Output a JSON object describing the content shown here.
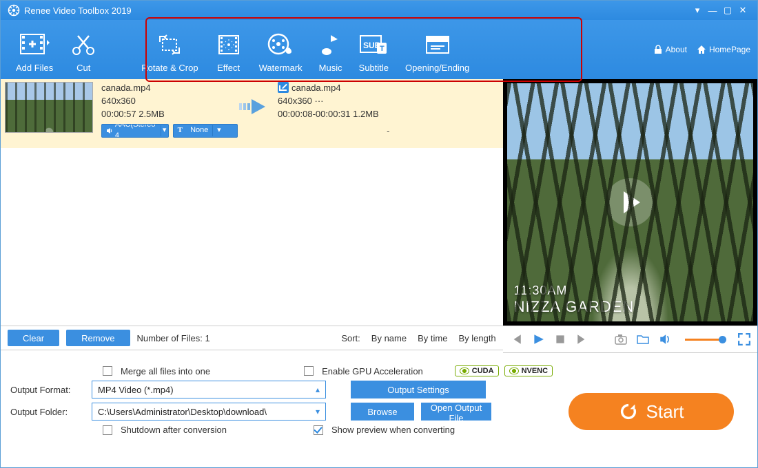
{
  "title": "Renee Video Toolbox 2019",
  "toolbar": {
    "add_files": "Add Files",
    "cut": "Cut",
    "rotate_crop": "Rotate & Crop",
    "effect": "Effect",
    "watermark": "Watermark",
    "music": "Music",
    "subtitle": "Subtitle",
    "opening_ending": "Opening/Ending",
    "about": "About",
    "homepage": "HomePage"
  },
  "file": {
    "src_name": "canada.mp4",
    "src_res": "640x360",
    "src_dur_size": "00:00:57  2.5MB",
    "dst_name": "canada.mp4",
    "dst_res": "640x360     ···",
    "dst_range_size": "00:00:08-00:00:31  1.2MB",
    "audio_pill": "AAC(Stereo 4",
    "text_pill": "None",
    "dash": "-"
  },
  "preview": {
    "time": "11:30AM",
    "place": "NIZZA GARDEN"
  },
  "footer": {
    "clear": "Clear",
    "remove": "Remove",
    "count_label": "Number of Files:  1",
    "sort_label": "Sort:",
    "by_name": "By name",
    "by_time": "By time",
    "by_length": "By length"
  },
  "settings": {
    "merge": "Merge all files into one",
    "gpu": "Enable GPU Acceleration",
    "cuda": "CUDA",
    "nvenc": "NVENC",
    "out_format_label": "Output Format:",
    "out_format_value": "MP4 Video (*.mp4)",
    "output_settings": "Output Settings",
    "out_folder_label": "Output Folder:",
    "out_folder_value": "C:\\Users\\Administrator\\Desktop\\download\\",
    "browse": "Browse",
    "open_folder": "Open Output File",
    "shutdown": "Shutdown after conversion",
    "show_preview": "Show preview when converting",
    "start": "Start"
  }
}
